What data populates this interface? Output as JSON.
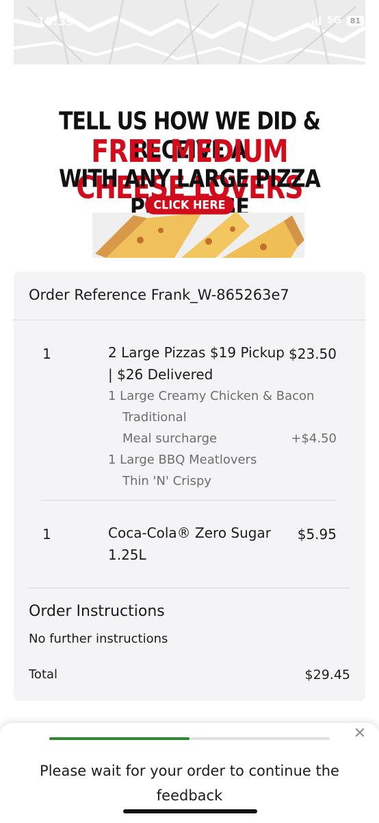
{
  "status_bar": {
    "time": "19:39",
    "network": "5G",
    "battery": "81"
  },
  "promo": {
    "line1": "TELL US HOW WE DID & RECEIVE A",
    "line2": "FREE MEDIUM CHEESE LOVERS",
    "line3": "WITH ANY LARGE PIZZA PURCHASE",
    "cta": "CLICK HERE",
    "accent_color": "#d10d1d"
  },
  "order": {
    "reference": "Order Reference Frank_W-865263e7",
    "items": [
      {
        "qty": "1",
        "name": "2 Large Pizzas $19 Pickup | $26 Delivered",
        "price": "$23.50",
        "details": [
          {
            "text": "1 Large Creamy Chicken & Bacon"
          },
          {
            "text": "Traditional"
          },
          {
            "text": "Meal surcharge",
            "price": "+$4.50"
          },
          {
            "text": "1 Large BBQ Meatlovers"
          },
          {
            "text": "Thin 'N' Crispy"
          }
        ]
      },
      {
        "qty": "1",
        "name": "Coca-Cola® Zero Sugar 1.25L",
        "price": "$5.95"
      }
    ],
    "instructions_title": "Order Instructions",
    "instructions_text": "No further instructions",
    "total_label": "Total",
    "total_value": "$29.45"
  },
  "feedback": {
    "message": "Please wait for your order to continue the feedback",
    "progress_fraction": 0.5,
    "progress_color": "#2f8a2f",
    "close_icon": "close-icon"
  }
}
